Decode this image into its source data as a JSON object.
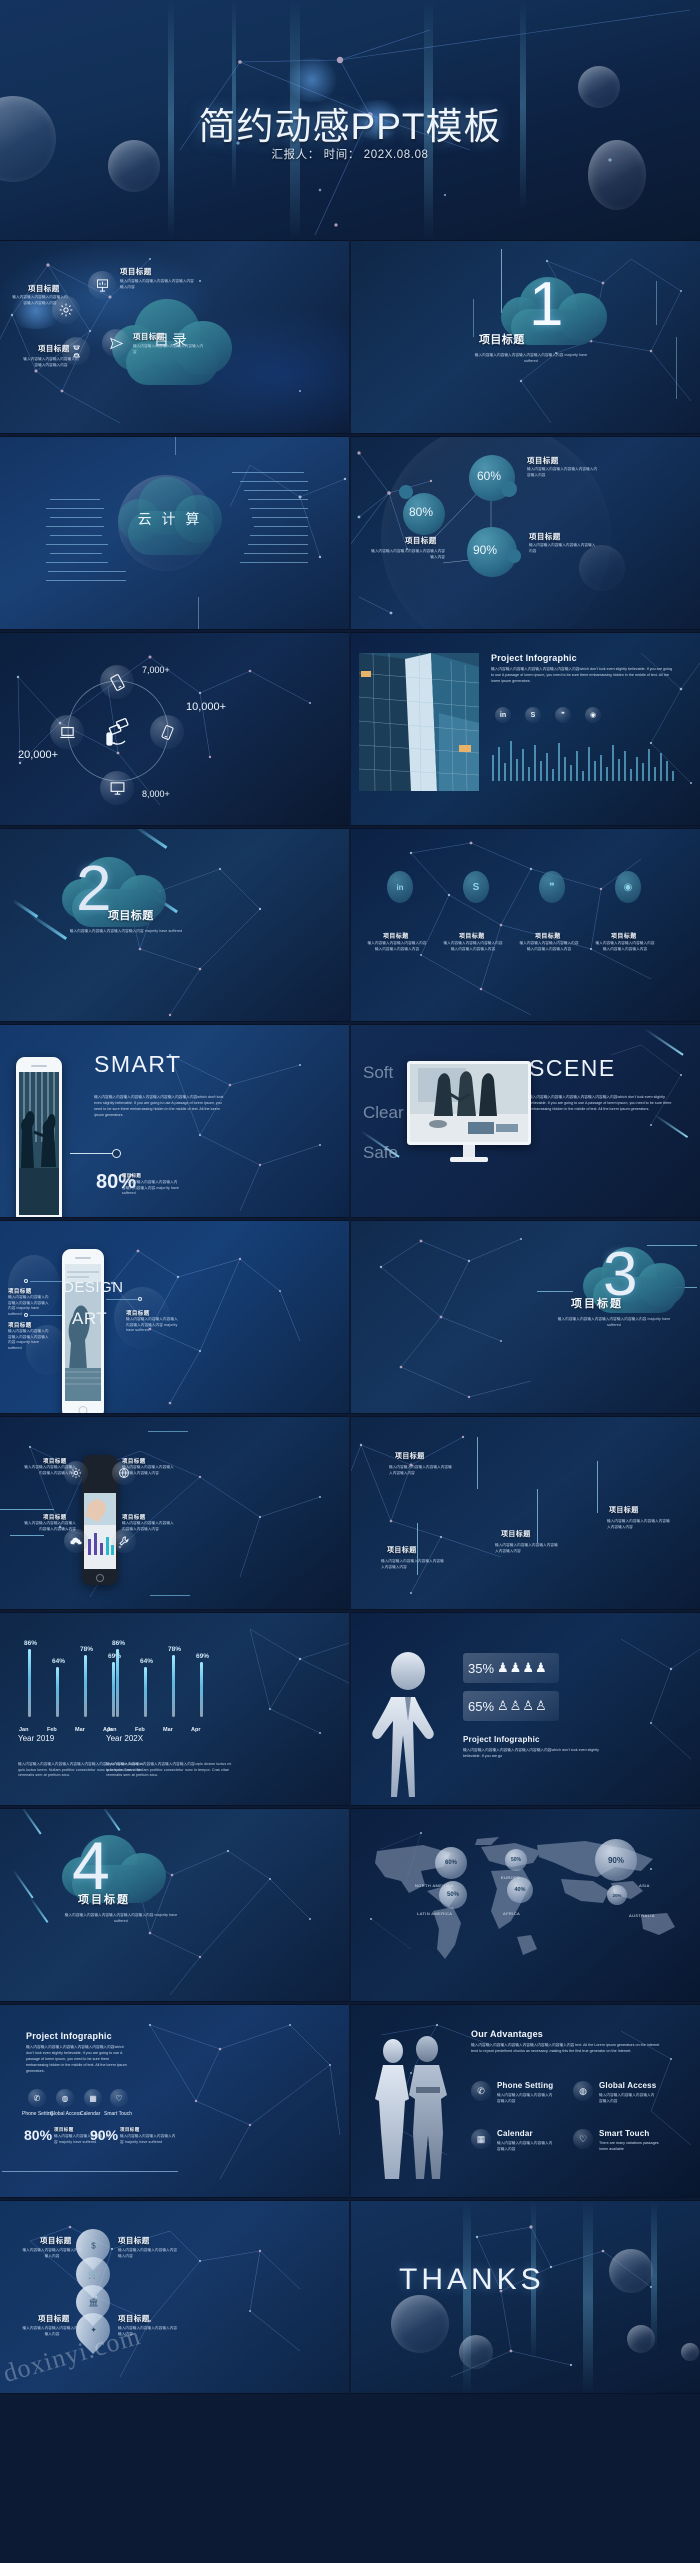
{
  "hero": {
    "title": "简约动感PPT模板",
    "subtitle": "汇报人： 时间： 202X.08.08"
  },
  "common": {
    "item_title": "项目标题",
    "cn_body": "输入内容输入内容输入内容输入内容输入内容输入内容输入内容",
    "cn_body_short": "输入内容输入内容输入内容输入内容",
    "cn_body_en": "输入内容输入内容输入内容输入内容 majority have suffered",
    "lorem": "which don't look even slightly believable. If you are going to use A passage of lorem ipsum, you need to be sure there embarrassing hidden in the middle of text. All the lorem ipsum generators."
  },
  "slides": [
    {
      "id": "catalog",
      "center_text": "目录",
      "items": [
        {
          "icon": "gear-icon",
          "label": "项目标题",
          "body": "输入内容输入内容输入内容输入内容输入内容输入内容"
        },
        {
          "icon": "chart-board-icon",
          "label": "项目标题",
          "body": "输入内容输入内容输入内容输入内容输入内容输入内容"
        },
        {
          "icon": "hourglass-icon",
          "label": "项目标题",
          "body": "输入内容输入内容输入内容输入内容输入内容输入内容"
        },
        {
          "icon": "paper-plane-icon",
          "label": "项目标题",
          "body": "输入内容输入内容输入内容输入内容输入内容"
        }
      ]
    },
    {
      "id": "section-1",
      "number": "1",
      "title": "项目标题",
      "body": "输入内容输入内容输入内容输入内容输入内容输入内容 majority have suffered"
    },
    {
      "id": "cloud-computing",
      "center_text": "云 计 算"
    },
    {
      "id": "percent-bubbles",
      "bubbles": [
        {
          "value": "60%",
          "label": "项目标题",
          "body": "输入内容输入内容输入内容输入内容输入内容输入内容"
        },
        {
          "value": "80%",
          "label": "项目标题",
          "body": "输入内容输入内容输入内容输入内容输入内容输入内容"
        },
        {
          "value": "90%",
          "label": "项目标题",
          "body": "输入内容输入内容输入内容输入内容输入内容"
        }
      ]
    },
    {
      "id": "device-counts",
      "counts": [
        {
          "value": "7,000+",
          "icon": "tablet-icon"
        },
        {
          "value": "10,000+",
          "icon": "phone-icon"
        },
        {
          "value": "8,000+",
          "icon": "monitor-icon"
        },
        {
          "value": "20,000+",
          "icon": "laptop-icon"
        }
      ],
      "center_icon": "hand-card-icon"
    },
    {
      "id": "project-infographic-building",
      "heading": "Project Infographic",
      "body": "输入内容输入内容输入内容输入内容输入内容输入内容which don't look even slightly believable. If you are going to use A passage of lorem ipsum, you need to be sure there embarrassing hidden in the middle of text. All the lorem ipsum generators.",
      "social": [
        "linkedin-icon",
        "skype-icon",
        "wechat-icon",
        "weibo-icon"
      ]
    },
    {
      "id": "section-2",
      "number": "2",
      "title": "项目标题",
      "body": "输入内容输入内容输入内容输入内容输入内容 majority have suffered"
    },
    {
      "id": "social-four",
      "items": [
        {
          "icon": "linkedin-icon",
          "label": "项目标题",
          "body": "输入内容输入内容输入内容输入内容输入内容输入内容输入内容"
        },
        {
          "icon": "skype-icon",
          "label": "项目标题",
          "body": "输入内容输入内容输入内容输入内容输入内容输入内容输入内容"
        },
        {
          "icon": "wechat-icon",
          "label": "项目标题",
          "body": "输入内容输入内容输入内容输入内容输入内容输入内容输入内容"
        },
        {
          "icon": "weibo-icon",
          "label": "项目标题",
          "body": "输入内容输入内容输入内容输入内容输入内容输入内容输入内容"
        }
      ]
    },
    {
      "id": "smart",
      "heading": "SMART",
      "body": "输入内容输入内容输入内容输入内容输入内容输入内容输入内容which don't look even slightly believable. If you are going to use A passage of lorem ipsum, you need to be sure there embarrassing hidden in the middle of text. All the lorem ipsum generators.",
      "percent": "80%",
      "percent_label": "项目标题",
      "percent_body": "输入内容输入内容输入内容输入内容输入内容输入内容 majority have suffered"
    },
    {
      "id": "scene",
      "heading": "SCENE",
      "words": [
        "Soft",
        "Clear",
        "Safe"
      ],
      "body": "输入内容输入内容输入内容输入内容输入内容输入内容which don't look even slightly believable. If you are going to use A passage of lorem ipsum, you need to be sure there embarrassing hidden in the middle of text. All the lorem ipsum generators."
    },
    {
      "id": "design-art",
      "screen_words": [
        "DESIGN",
        "ART"
      ],
      "items": [
        {
          "label": "项目标题",
          "body": "输入内容输入内容输入内容输入内容输入内容输入内容 majority have suffered"
        },
        {
          "label": "项目标题",
          "body": "输入内容输入内容输入内容输入内容输入内容输入内容 majority have suffered"
        },
        {
          "label": "项目标题",
          "body": "输入内容输入内容输入内容输入内容输入内容输入内容 majority have suffered"
        }
      ]
    },
    {
      "id": "section-3",
      "number": "3",
      "title": "项目标题",
      "body": "输入内容输入内容输入内容输入内容输入内容输入内容 majority have suffered"
    },
    {
      "id": "phone-four-icons",
      "items": [
        {
          "icon": "gear-icon",
          "label": "项目标题",
          "body": "输入内容输入内容输入内容输入内容输入内容输入内容"
        },
        {
          "icon": "globe-icon",
          "label": "项目标题",
          "body": "输入内容输入内容输入内容输入内容输入内容输入内容"
        },
        {
          "icon": "cloud-download-icon",
          "label": "项目标题",
          "body": "输入内容输入内容输入内容输入内容输入内容输入内容"
        },
        {
          "icon": "wrench-icon",
          "label": "项目标题",
          "body": "输入内容输入内容输入内容输入内容输入内容输入内容"
        }
      ]
    },
    {
      "id": "timeline-titles",
      "items": [
        {
          "label": "项目标题",
          "body": "输入内容输入内容输入内容输入内容输入内容输入内容"
        },
        {
          "label": "项目标题",
          "body": "输入内容输入内容输入内容输入内容输入内容输入内容"
        },
        {
          "label": "项目标题",
          "body": "输入内容输入内容输入内容输入内容输入内容输入内容"
        },
        {
          "label": "项目标题",
          "body": "输入内容输入内容输入内容输入内容输入内容输入内容"
        }
      ]
    },
    {
      "id": "bar-charts",
      "groups": [
        {
          "year": "Year 2019",
          "body": "输入内容输入内容输入内容输入内容输入内容输入内容urpis dictum luctus mi quis luctus lorem. Nullam porttitor consectetur nunc in tempor. Cras vitae venenatis sem at pretium arcu.",
          "categories": [
            "Jan",
            "Feb",
            "Mar",
            "Apr"
          ],
          "values": [
            86,
            64,
            78,
            69
          ]
        },
        {
          "year": "Year 202X",
          "body": "输入内容输入内容输入内容输入内容输入内容输入内容urpis dictum luctus mi quis luctus lorem. Nullam porttitor consectetur nunc in tempor. Cras vitae venenatis sem at pretium arcu.",
          "categories": [
            "Jan",
            "Feb",
            "Mar",
            "Apr"
          ],
          "values": [
            86,
            64,
            78,
            69
          ]
        }
      ]
    },
    {
      "id": "gender-split",
      "heading": "Project Infographic",
      "body": "输入内容输入内容输入内容输入内容输入内容输入内容which don't look even slightly believable. If you are go",
      "rows": [
        {
          "value": "35%",
          "icon": "male-figure-icon",
          "count": 4
        },
        {
          "value": "65%",
          "icon": "female-figure-icon",
          "count": 4
        }
      ]
    },
    {
      "id": "section-4",
      "number": "4",
      "title": "项目标题",
      "body": "输入内容输入内容输入内容输入内容输入内容输入内容 majority have suffered"
    },
    {
      "id": "world-map",
      "regions": [
        {
          "name": "NORTH AMERICA",
          "value": "60%"
        },
        {
          "name": "EUROPE",
          "value": "50%"
        },
        {
          "name": "ASIA",
          "value": "90%"
        },
        {
          "name": "LATIN AMERICA",
          "value": "50%"
        },
        {
          "name": "AFRICA",
          "value": "40%"
        },
        {
          "name": "AUSTRALIA",
          "value": "20%"
        }
      ]
    },
    {
      "id": "infographic-features",
      "heading": "Project Infographic",
      "body": "输入内容输入内容输入内容输入内容输入内容输入内容which don't look even slightly believable. If you are going to use A passage of lorem ipsum, you need to be sure there embarrassing hidden in the middle of text. All the lorem ipsum generators.",
      "features": [
        {
          "icon": "phone-icon",
          "label": "Phone Setting"
        },
        {
          "icon": "globe-icon",
          "label": "Global Access"
        },
        {
          "icon": "calendar-icon",
          "label": "Calendar"
        },
        {
          "icon": "bulb-icon",
          "label": "Smart Touch"
        }
      ],
      "stats": [
        {
          "value": "80%",
          "label": "项目标题",
          "body": "输入内容输入内容输入内容输入内容 majority have suffered"
        },
        {
          "value": "90%",
          "label": "项目标题",
          "body": "输入内容输入内容输入内容输入内容 majority have suffered"
        }
      ]
    },
    {
      "id": "our-advantages",
      "heading": "Our Advantages",
      "body": "输入内容输入内容输入内容输入内容输入内容输入内容输入内容 text. All the Lorem Ipsum generators on the Internet tend to repeat predefined chunks as necessary, making this the first true generator on the Internet.",
      "features": [
        {
          "icon": "phone-icon",
          "label": "Phone Setting",
          "body": "输入内容输入内容输入内容输入内容输入内容"
        },
        {
          "icon": "globe-icon",
          "label": "Global Access",
          "body": "输入内容输入内容输入内容输入内容输入内容"
        },
        {
          "icon": "calendar-icon",
          "label": "Calendar",
          "body": "输入内容输入内容输入内容输入内容输入内容"
        },
        {
          "icon": "bulb-icon",
          "label": "Smart Touch",
          "body": "There are many variations passages lorem available"
        }
      ]
    },
    {
      "id": "pin-stack",
      "watermark": "doxinyi.com",
      "pins": [
        "dollar-icon",
        "cart-icon",
        "bank-icon",
        "box-icon"
      ],
      "items": [
        {
          "label": "项目标题",
          "body": "输入内容输入内容输入内容输入内容输入内容"
        },
        {
          "label": "项目标题",
          "body": "输入内容输入内容输入内容输入内容输入内容"
        },
        {
          "label": "项目标题",
          "body": "输入内容输入内容输入内容输入内容输入内容"
        },
        {
          "label": "项目标题",
          "body": "输入内容输入内容输入内容输入内容输入内容"
        }
      ]
    },
    {
      "id": "thanks",
      "title": "THANKS"
    }
  ]
}
